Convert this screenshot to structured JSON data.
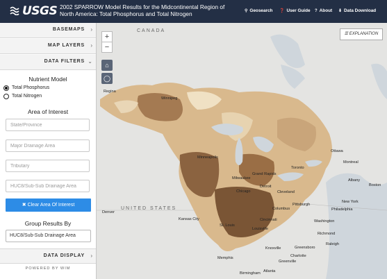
{
  "header": {
    "logo": "USGS",
    "title": "2002 SPARROW Model Results for the Midcontinental Region of North America: Total Phosphorus and Total Nitrogen",
    "nav": [
      {
        "label": "Geosearch",
        "icon": "search-icon"
      },
      {
        "label": "User Guide",
        "icon": "question-icon"
      },
      {
        "label": "About",
        "icon": "question-icon"
      },
      {
        "label": "Data Download",
        "icon": "download-icon"
      }
    ]
  },
  "sidebar": {
    "basemaps": "BASEMAPS",
    "map_layers": "MAP LAYERS",
    "data_filters": "DATA FILTERS",
    "nutrient_model": {
      "title": "Nutrient Model",
      "options": [
        {
          "label": "Total Phosphorus",
          "selected": true
        },
        {
          "label": "Total Nitrogen",
          "selected": false
        }
      ]
    },
    "area_of_interest": {
      "title": "Area of Interest",
      "placeholders": [
        "State/Province",
        "Major Drainage Area",
        "Tributary",
        "HUC8/Sub-Sub Drainage Area"
      ]
    },
    "clear_button": "Clear Area Of Interest",
    "group_results": {
      "title": "Group Results By",
      "value": "HUC8/Sub-Sub Drainage Area"
    },
    "data_display": "DATA DISPLAY",
    "powered_by": "POWERED BY WIM"
  },
  "map": {
    "explanation": "EXPLANATION",
    "zoom_in": "+",
    "zoom_out": "−",
    "labels": {
      "canada": "CANADA",
      "usa": "UNITED STATES",
      "regina": "Regina",
      "winnipeg": "Winnipeg",
      "ottawa": "Ottawa",
      "montreal": "Montreal",
      "albany": "Albany",
      "boston": "Boston",
      "new_york": "New York",
      "philadelphia": "Philadelphia",
      "washington": "Washington",
      "richmond": "Richmond",
      "raleigh": "Raleigh",
      "charlotte": "Charlotte",
      "greensboro": "Greensboro",
      "knoxville": "Knoxville",
      "greenville": "Greenville",
      "atlanta": "Atlanta",
      "birmingham": "Birmingham",
      "memphis": "Memphis",
      "kansas_city": "Kansas City",
      "denver": "Denver",
      "st_louis": "St. Louis",
      "chicago": "Chicago",
      "detroit": "Detroit",
      "toronto": "Toronto",
      "minneapolis": "Minneapolis",
      "cleveland": "Cleveland",
      "columbus": "Columbus",
      "pittsburgh": "Pittsburgh",
      "cincinnati": "Cincinnati",
      "louisville": "Louisville",
      "milwaukee": "Milwaukee",
      "grand_rapids": "Grand Rapids"
    }
  }
}
